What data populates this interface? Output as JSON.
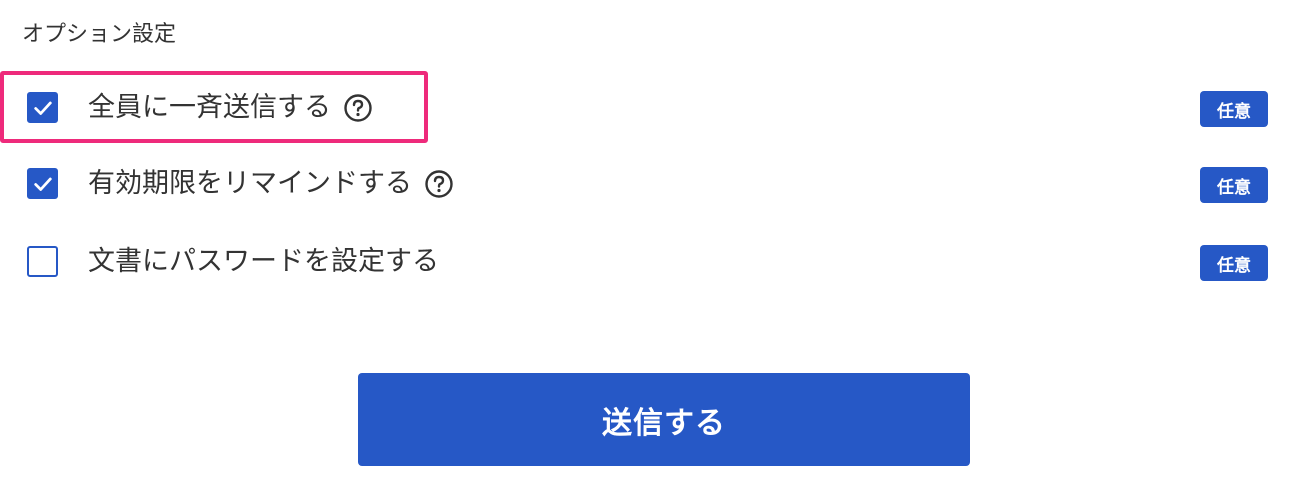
{
  "section": {
    "title": "オプション設定"
  },
  "options": [
    {
      "label": "全員に一斉送信する",
      "checked": true,
      "has_help": true,
      "badge": "任意"
    },
    {
      "label": "有効期限をリマインドする",
      "checked": true,
      "has_help": true,
      "badge": "任意"
    },
    {
      "label": "文書にパスワードを設定する",
      "checked": false,
      "has_help": false,
      "badge": "任意"
    }
  ],
  "submit": {
    "label": "送信する"
  },
  "colors": {
    "accent": "#2658c6",
    "highlight": "#ee2a7b",
    "text": "#333333"
  },
  "icons": {
    "checkbox_check": "check-icon",
    "help": "question-circle-icon"
  }
}
